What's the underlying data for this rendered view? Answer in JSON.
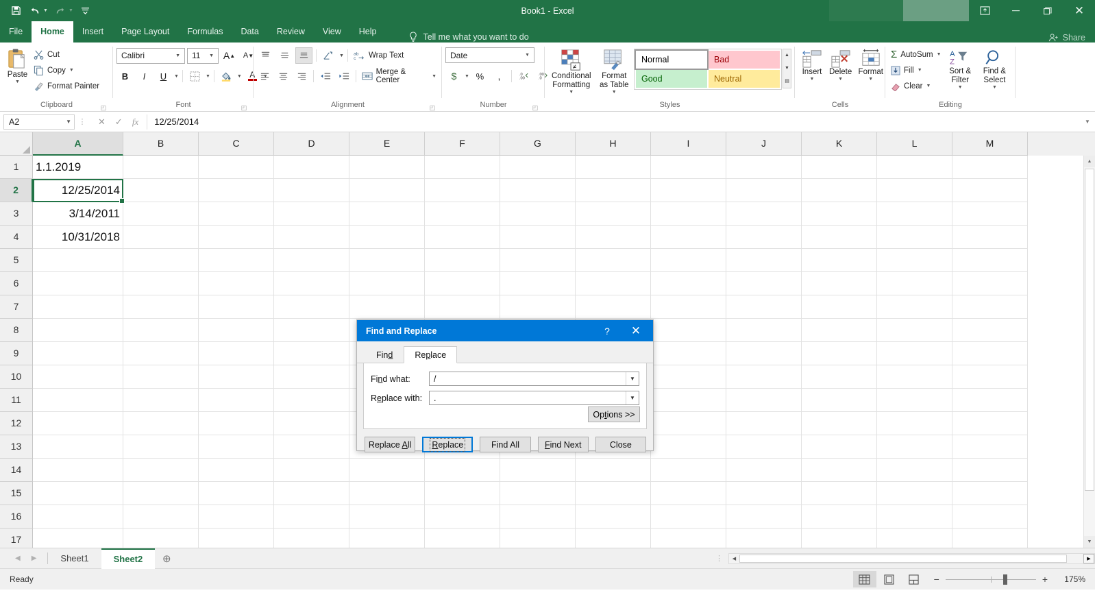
{
  "window": {
    "title": "Book1  -  Excel",
    "quick_access": [
      {
        "name": "save-icon",
        "glyph": "ὋE"
      },
      {
        "name": "undo-icon",
        "glyph": "↶"
      },
      {
        "name": "redo-icon",
        "glyph": "↷"
      },
      {
        "name": "customize-qat-icon",
        "glyph": "▾"
      }
    ],
    "controls": {
      "ribbon_display": "❐",
      "minimize": "—",
      "maximize": "❐",
      "close": "✕"
    }
  },
  "tabs": {
    "items": [
      "File",
      "Home",
      "Insert",
      "Page Layout",
      "Formulas",
      "Data",
      "Review",
      "View",
      "Help"
    ],
    "active": "Home",
    "tell_me": "Tell me what you want to do",
    "share": "Share"
  },
  "ribbon": {
    "clipboard": {
      "name": "Clipboard",
      "paste": "Paste",
      "cut": "Cut",
      "copy": "Copy",
      "format_painter": "Format Painter"
    },
    "font": {
      "name": "Font",
      "family": "Calibri",
      "size": "11",
      "grow": "A",
      "shrink": "A",
      "bold": "B",
      "italic": "I",
      "underline": "U",
      "borders": "⌸",
      "fill_color": "▲",
      "font_color": "A"
    },
    "alignment": {
      "name": "Alignment",
      "wrap_text": "Wrap Text",
      "merge_center": "Merge & Center",
      "orientation": "⤴"
    },
    "number": {
      "name": "Number",
      "format": "Date",
      "currency": "$",
      "percent": "%",
      "comma": ",",
      "increase_decimal": ".00",
      "decrease_decimal": ".00"
    },
    "styles": {
      "name": "Styles",
      "conditional_formatting": "Conditional Formatting",
      "format_as_table": "Format as Table",
      "cell_styles": [
        {
          "label": "Normal",
          "bg": "#ffffff",
          "fg": "#000000",
          "selected": true
        },
        {
          "label": "Bad",
          "bg": "#ffc7ce",
          "fg": "#9c0006",
          "selected": false
        },
        {
          "label": "Good",
          "bg": "#c6efce",
          "fg": "#006100",
          "selected": false
        },
        {
          "label": "Neutral",
          "bg": "#ffeb9c",
          "fg": "#9c6500",
          "selected": false
        }
      ]
    },
    "cells": {
      "name": "Cells",
      "insert": "Insert",
      "delete": "Delete",
      "format": "Format"
    },
    "editing": {
      "name": "Editing",
      "autosum": "AutoSum",
      "fill": "Fill",
      "clear": "Clear",
      "sort_filter": "Sort & Filter",
      "find_select": "Find & Select"
    }
  },
  "formula_bar": {
    "name_box": "A2",
    "value": "12/25/2014",
    "cancel_icon": "✕",
    "enter_icon": "✓",
    "fx_icon": "fx"
  },
  "grid": {
    "columns": [
      "A",
      "B",
      "C",
      "D",
      "E",
      "F",
      "G",
      "H",
      "I",
      "J",
      "K",
      "L",
      "M"
    ],
    "selected_column": "A",
    "rows": [
      "1",
      "2",
      "3",
      "4",
      "5",
      "6",
      "7",
      "8",
      "9",
      "10",
      "11",
      "12",
      "13",
      "14",
      "15",
      "16",
      "17"
    ],
    "selected_row": "2",
    "cells": [
      {
        "row": "1",
        "value": "1.1.2019",
        "align": "left"
      },
      {
        "row": "2",
        "value": "12/25/2014",
        "align": "right"
      },
      {
        "row": "3",
        "value": "3/14/2011",
        "align": "right"
      },
      {
        "row": "4",
        "value": "10/31/2018",
        "align": "right"
      }
    ],
    "active_cell": "A2"
  },
  "sheets": {
    "items": [
      {
        "label": "Sheet1",
        "active": false
      },
      {
        "label": "Sheet2",
        "active": true
      }
    ],
    "add_label": "⊕",
    "prev": "◀",
    "next": "▶"
  },
  "status": {
    "ready": "Ready",
    "views": [
      {
        "name": "normal-view",
        "glyph": "☷",
        "active": true
      },
      {
        "name": "page-layout-view",
        "glyph": "▤",
        "active": false
      },
      {
        "name": "page-break-view",
        "glyph": "▥",
        "active": false
      }
    ],
    "zoom_out": "−",
    "zoom_in": "+",
    "zoom": "175%"
  },
  "dialog": {
    "title": "Find and Replace",
    "help": "?",
    "close": "✕",
    "tabs": [
      {
        "label": "Find",
        "active": false
      },
      {
        "label": "Replace",
        "active": true
      }
    ],
    "fields": [
      {
        "label": "Find what:",
        "value": "/"
      },
      {
        "label": "Replace with:",
        "value": "."
      }
    ],
    "options_button": "Options >>",
    "buttons": [
      {
        "label": "Replace All",
        "focused": false
      },
      {
        "label": "Replace",
        "focused": true
      },
      {
        "label": "Find All",
        "focused": false
      },
      {
        "label": "Find Next",
        "focused": false
      },
      {
        "label": "Close",
        "focused": false
      }
    ]
  }
}
